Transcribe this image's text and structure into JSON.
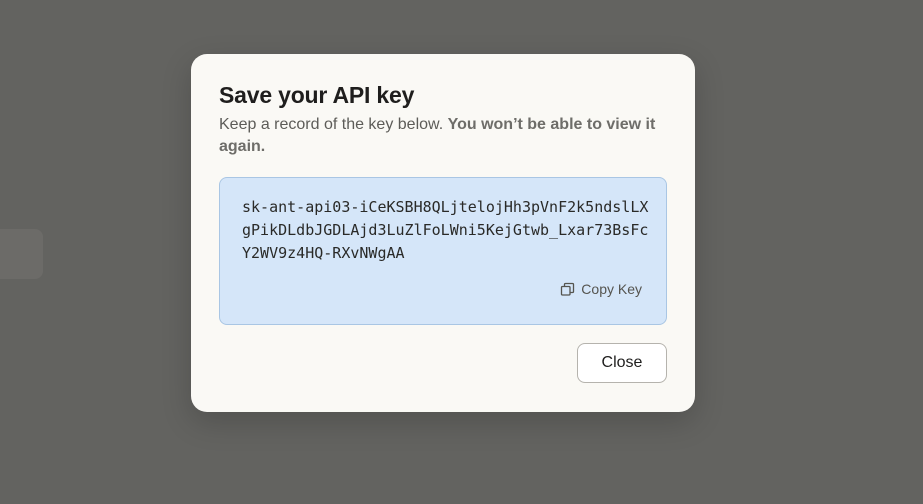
{
  "dialog": {
    "title": "Save your API key",
    "description_plain": "Keep a record of the key below. ",
    "description_bold": "You won’t be able to view it again.",
    "api_key": "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",
    "copy_label": "Copy Key",
    "copy_icon": "copy-icon",
    "close_label": "Close"
  },
  "colors": {
    "overlay": "#636360",
    "modal_background": "#faf9f5",
    "key_box_background": "#d5e6f9",
    "key_box_border": "#a9c6e4"
  }
}
